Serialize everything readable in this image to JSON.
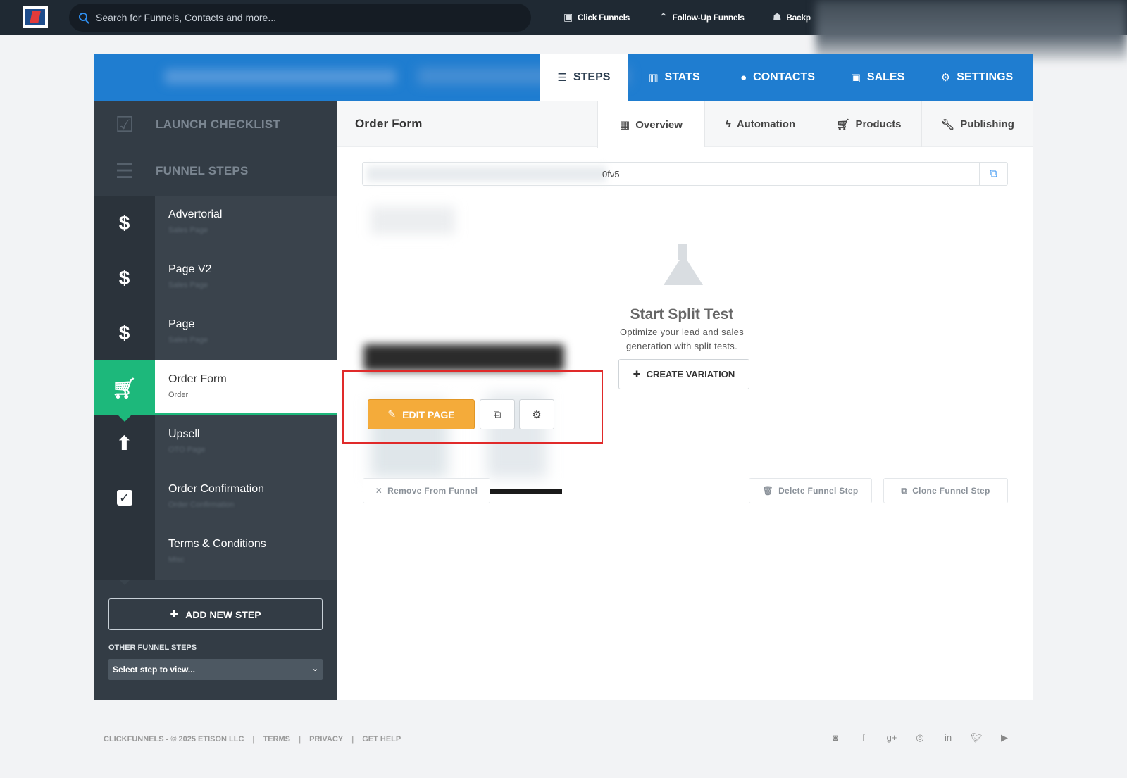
{
  "topbar": {
    "search_placeholder": "Search for Funnels, Contacts and more...",
    "links": [
      {
        "label": "Click Funnels",
        "icon": "clickfunnels-icon"
      },
      {
        "label": "Follow-Up Funnels",
        "icon": "follow-up-icon"
      },
      {
        "label": "Backp",
        "icon": "backpack-icon"
      }
    ]
  },
  "header": {
    "tabs": [
      {
        "label": "STEPS",
        "icon": "list-icon"
      },
      {
        "label": "STATS",
        "icon": "bar-chart-icon"
      },
      {
        "label": "CONTACTS",
        "icon": "users-icon"
      },
      {
        "label": "SALES",
        "icon": "money-icon"
      },
      {
        "label": "SETTINGS",
        "icon": "gear-icon"
      }
    ]
  },
  "sidebar": {
    "launch_checklist": "LAUNCH CHECKLIST",
    "funnel_steps": "FUNNEL STEPS",
    "steps": [
      {
        "title": "Advertorial",
        "subtitle": "Sales Page",
        "icon": "dollar-icon"
      },
      {
        "title": "Page V2",
        "subtitle": "Sales Page",
        "icon": "dollar-icon"
      },
      {
        "title": "Page",
        "subtitle": "Sales Page",
        "icon": "dollar-icon"
      },
      {
        "title": "Order Form",
        "subtitle": "Order",
        "icon": "cart-icon",
        "active": true
      },
      {
        "title": "Upsell",
        "subtitle": "OTO Page",
        "icon": "arrow-up-icon"
      },
      {
        "title": "Order Confirmation",
        "subtitle": "Order Confirmation",
        "icon": "checkbox-icon"
      },
      {
        "title": "Terms & Conditions",
        "subtitle": "Misc",
        "icon": ""
      }
    ],
    "add_step": "ADD NEW STEP",
    "other_label": "OTHER FUNNEL STEPS",
    "select_value": "Select step to view..."
  },
  "main": {
    "title": "Order Form",
    "subtabs": [
      {
        "label": "Overview",
        "icon": "grid-icon"
      },
      {
        "label": "Automation",
        "icon": "bolt-icon"
      },
      {
        "label": "Products",
        "icon": "cart-icon"
      },
      {
        "label": "Publishing",
        "icon": "wrench-icon"
      }
    ],
    "url_suffix": "0fv5",
    "edit_page": "EDIT PAGE",
    "split_title": "Start Split Test",
    "split_desc": "Optimize your lead and sales generation with split tests.",
    "create_variation": "CREATE VARIATION",
    "remove": "Remove From Funnel",
    "delete": "Delete Funnel Step",
    "clone": "Clone Funnel Step"
  },
  "footer": {
    "copyright": "CLICKFUNNELS - © 2025 ETISON LLC",
    "terms": "TERMS",
    "privacy": "PRIVACY",
    "help": "GET HELP",
    "separator": "|",
    "social_icons": [
      "rss-icon",
      "facebook-icon",
      "google-plus-icon",
      "instagram-icon",
      "linkedin-icon",
      "twitter-icon",
      "youtube-icon"
    ]
  },
  "colors": {
    "topbar": "#1f2933",
    "header_blue": "#1f7dd0",
    "sidebar": "#333c45",
    "active_green": "#1db87b",
    "edit_orange": "#f4ab3a",
    "highlight_red": "#e02a2a"
  }
}
